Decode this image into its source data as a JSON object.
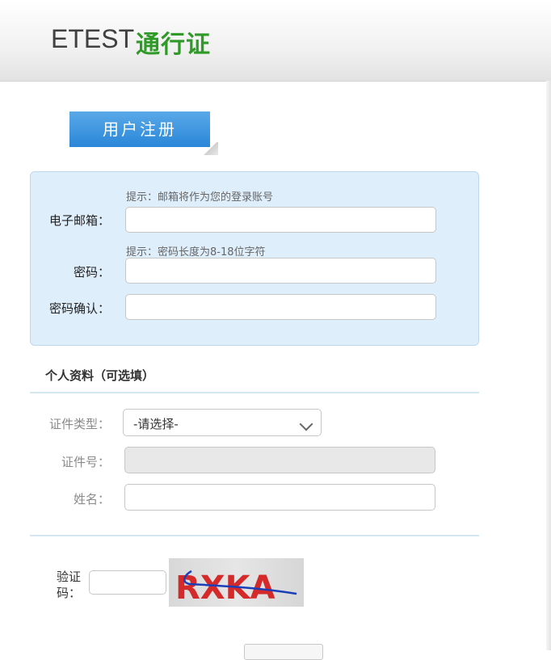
{
  "header": {
    "logo_text": "ETEST",
    "logo_cn": "通行证"
  },
  "register_tab": {
    "label": "用户注册"
  },
  "account": {
    "email": {
      "hint": "提示：邮箱将作为您的登录账号",
      "label": "电子邮箱：",
      "value": "",
      "placeholder": ""
    },
    "password": {
      "hint": "提示：密码长度为8-18位字符",
      "label": "密码：",
      "value": "",
      "placeholder": ""
    },
    "password_confirm": {
      "label": "密码确认：",
      "value": "",
      "placeholder": ""
    }
  },
  "profile": {
    "title": "个人资料（可选填）",
    "id_type": {
      "label": "证件类型：",
      "selected": "-请选择-"
    },
    "id_number": {
      "label": "证件号：",
      "value": ""
    },
    "name": {
      "label": "姓名：",
      "value": ""
    }
  },
  "captcha": {
    "label": "验证码：",
    "value": "",
    "image_text": "RXKA"
  },
  "colors": {
    "brand_green": "#2f9a28",
    "tab_blue": "#2a86d8",
    "box_bg": "#dfeefb",
    "captcha_red": "#d42a2a",
    "captcha_line": "#1a3fb8"
  }
}
